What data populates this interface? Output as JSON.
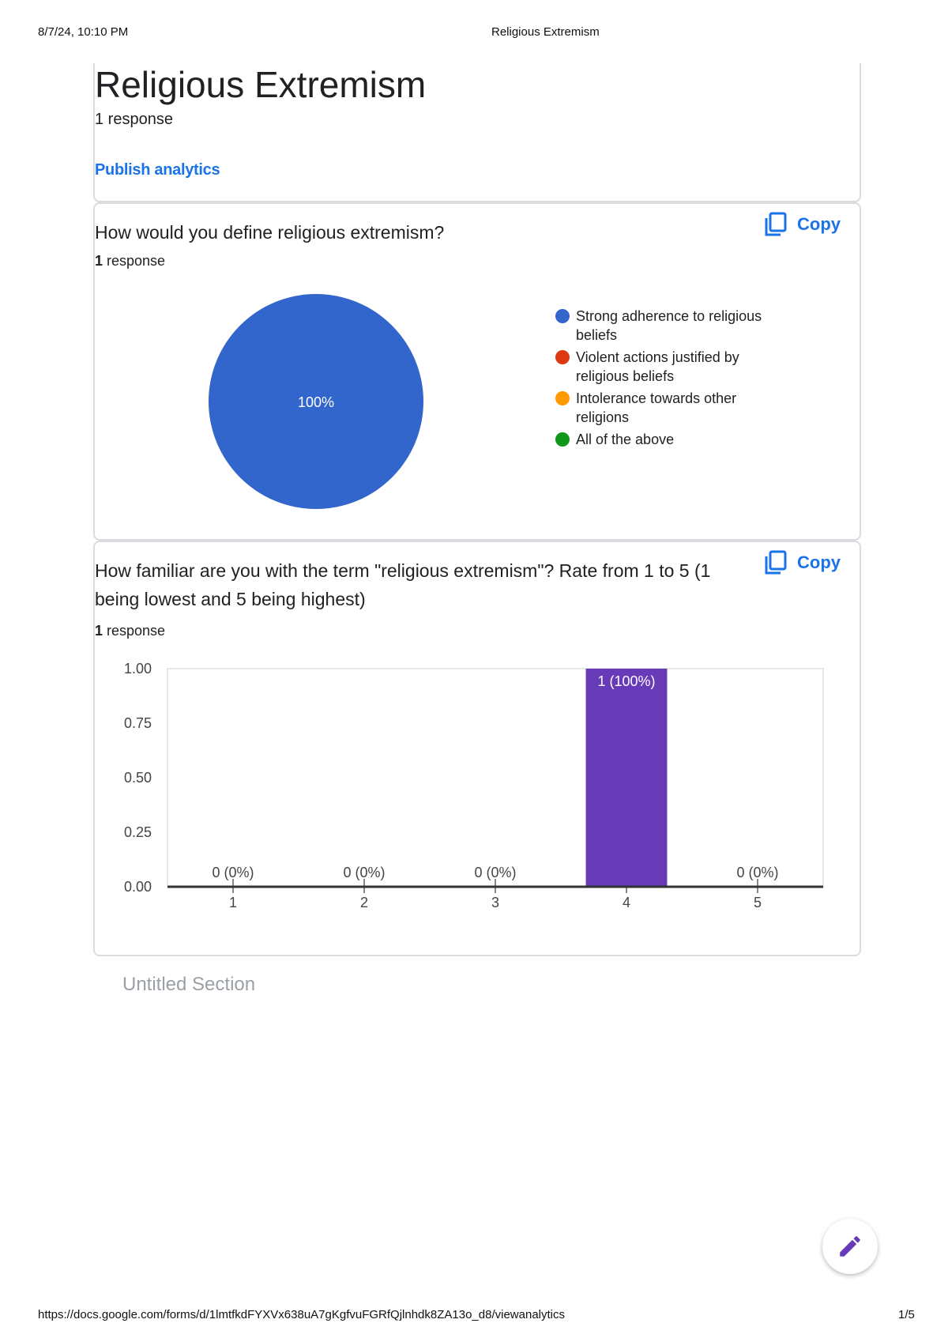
{
  "print_header": {
    "datetime": "8/7/24, 10:10 PM",
    "title": "Religious Extremism"
  },
  "print_footer": {
    "url": "https://docs.google.com/forms/d/1lmtfkdFYXVx638uA7gKgfvuFGRfQjlnhdk8ZA13o_d8/viewanalytics",
    "page": "1/5"
  },
  "form": {
    "title": "Religious Extremism",
    "responses": "1 response",
    "publish_label": "Publish analytics"
  },
  "copy_label": "Copy",
  "question1": {
    "title": "How would you define religious extremism?",
    "response_count": "1",
    "response_word": " response",
    "legend": [
      {
        "label": "Strong adherence to religious beliefs",
        "color": "#3366cc"
      },
      {
        "label": "Violent actions justified by religious beliefs",
        "color": "#dc3912"
      },
      {
        "label": "Intolerance towards other religions",
        "color": "#ff9900"
      },
      {
        "label": "All of the above",
        "color": "#109618"
      }
    ]
  },
  "question2": {
    "title": "How familiar are you with the term \"religious extremism\"? Rate from 1 to 5 (1 being lowest and 5 being highest)",
    "response_count": "1",
    "response_word": " response"
  },
  "untitled_section": "Untitled Section",
  "fab_icon": "pencil-icon",
  "chart_data": [
    {
      "type": "pie",
      "categories": [
        "Strong adherence to religious beliefs",
        "Violent actions justified by religious beliefs",
        "Intolerance towards other religions",
        "All of the above"
      ],
      "values": [
        1,
        0,
        0,
        0
      ],
      "slice_labels": [
        "100%"
      ],
      "colors": [
        "#3366cc",
        "#dc3912",
        "#ff9900",
        "#109618"
      ],
      "legend": "right"
    },
    {
      "type": "bar",
      "categories": [
        "1",
        "2",
        "3",
        "4",
        "5"
      ],
      "values": [
        0,
        0,
        0,
        1,
        0
      ],
      "data_labels": [
        "0 (0%)",
        "0 (0%)",
        "0 (0%)",
        "1 (100%)",
        "0 (0%)"
      ],
      "ylim": [
        0,
        1
      ],
      "yticks": [
        "0.00",
        "0.25",
        "0.50",
        "0.75",
        "1.00"
      ],
      "color": "#673ab7",
      "grid": false
    }
  ]
}
